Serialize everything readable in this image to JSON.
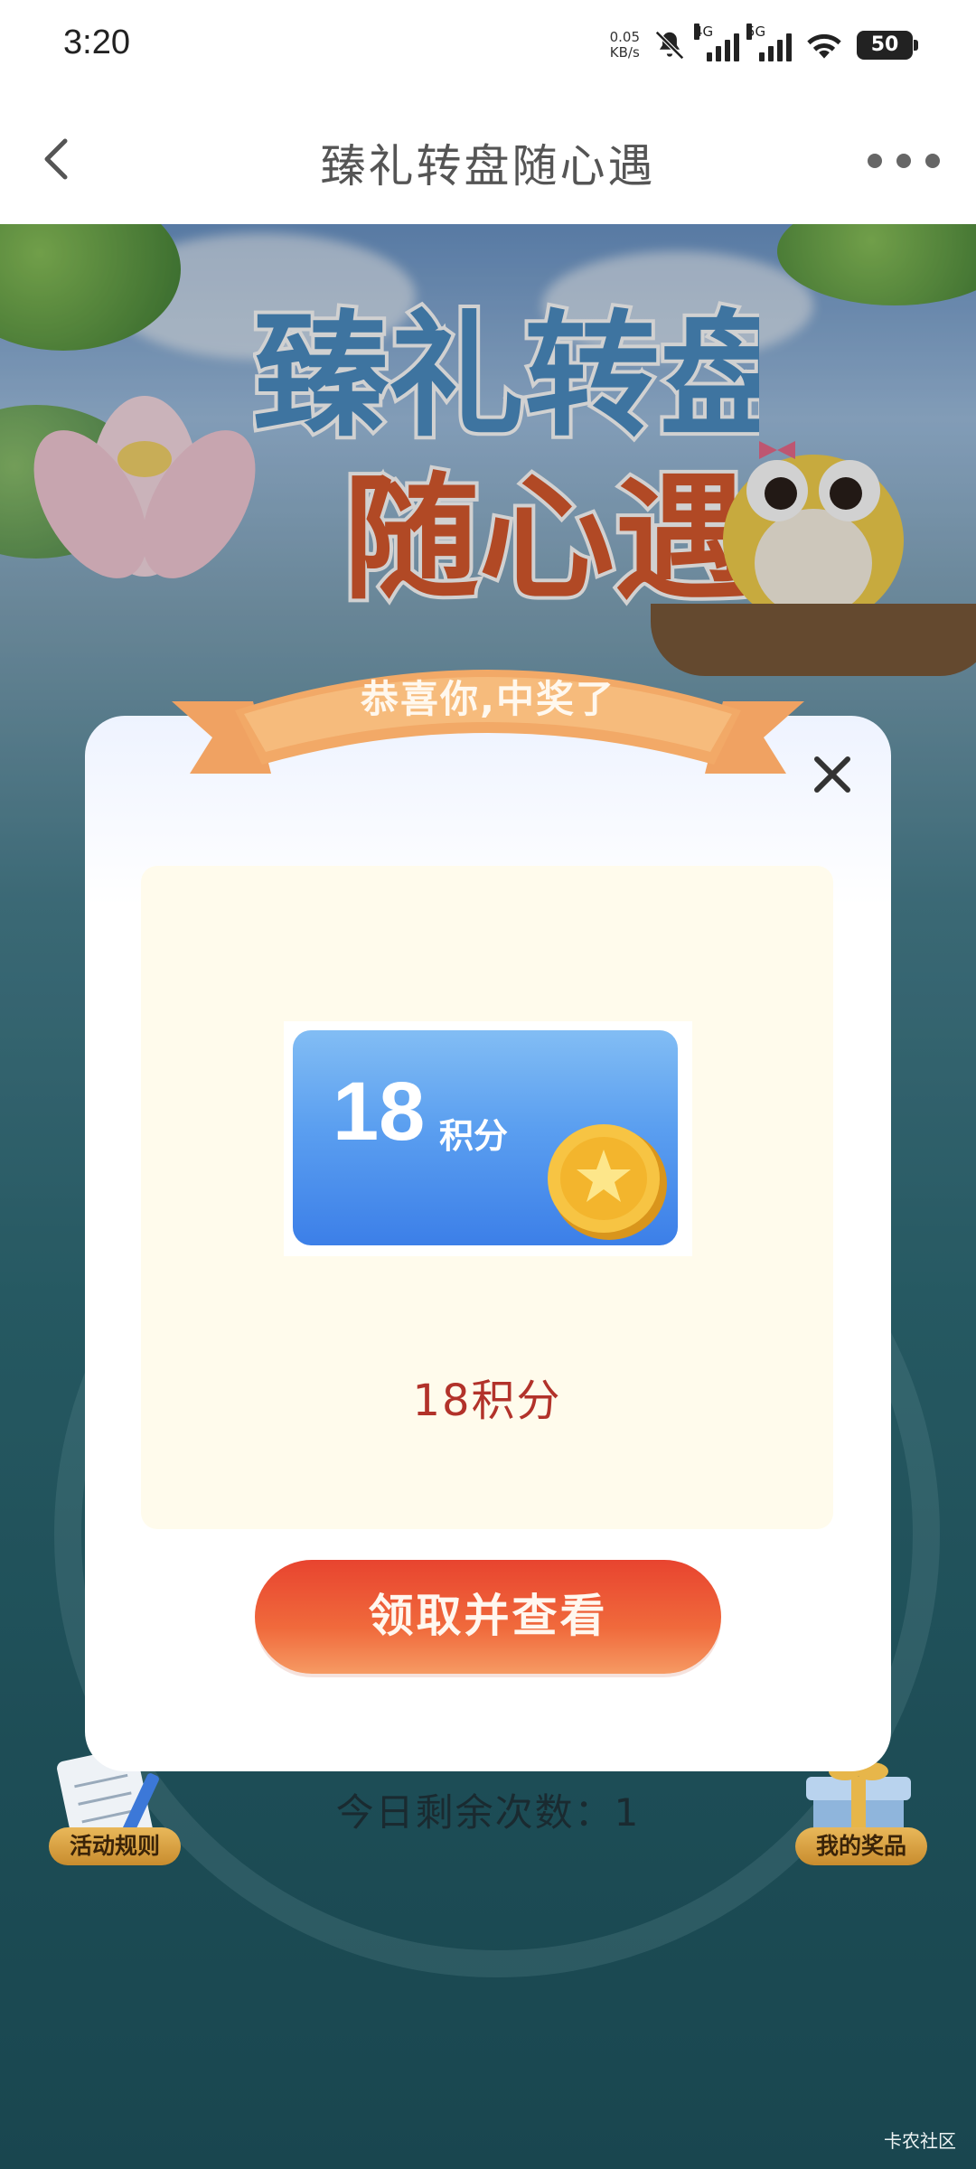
{
  "status_bar": {
    "time": "3:20",
    "net_speed_value": "0.05",
    "net_speed_unit": "KB/s",
    "signal1_label": "4G",
    "signal2_label": "5G",
    "wifi_label": "6",
    "battery": "50"
  },
  "nav": {
    "title": "臻礼转盘随心遇"
  },
  "background": {
    "promo_title_line1": "臻礼转盘",
    "promo_title_line2": "随心遇",
    "rules_label": "活动规则",
    "my_prizes_label": "我的奖品",
    "remaining_text": "今日剩余次数：1"
  },
  "dialog": {
    "banner_text": "恭喜你,中奖了",
    "card_amount": "18",
    "card_unit": "积分",
    "prize_name": "18积分",
    "claim_button": "领取并查看"
  },
  "watermark": "卡农社区",
  "colors": {
    "claim_button": "#ec5535",
    "prize_name": "#b2322a",
    "card_blue": "#4a8cec"
  }
}
